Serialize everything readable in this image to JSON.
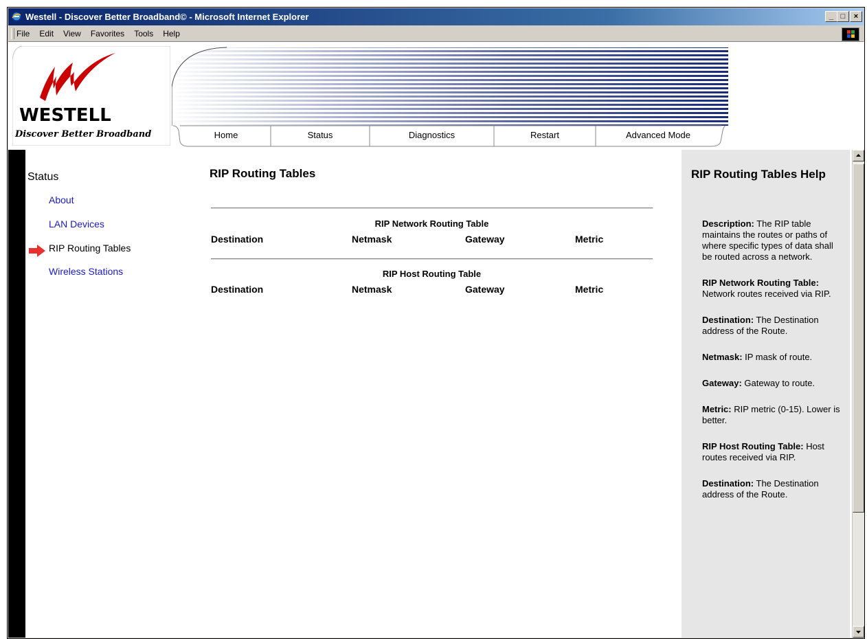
{
  "window": {
    "title": "Westell - Discover Better Broadband© - Microsoft Internet Explorer",
    "controls": {
      "minimize": "_",
      "maximize": "□",
      "close": "×"
    }
  },
  "menubar": {
    "items": [
      "File",
      "Edit",
      "View",
      "Favorites",
      "Tools",
      "Help"
    ]
  },
  "header": {
    "brand": "WESTELL",
    "tagline": "Discover Better Broadband",
    "tabs": [
      "Home",
      "Status",
      "Diagnostics",
      "Restart",
      "Advanced Mode"
    ]
  },
  "sidebar": {
    "heading": "Status",
    "items": [
      {
        "label": "About",
        "state": "link"
      },
      {
        "label": "LAN Devices",
        "state": "link"
      },
      {
        "label": "RIP Routing Tables",
        "state": "current"
      },
      {
        "label": "Wireless Stations",
        "state": "link"
      }
    ]
  },
  "main": {
    "title": "RIP Routing Tables",
    "tables": [
      {
        "title": "RIP Network Routing Table",
        "columns": [
          "Destination",
          "Netmask",
          "Gateway",
          "Metric"
        ]
      },
      {
        "title": "RIP Host Routing Table",
        "columns": [
          "Destination",
          "Netmask",
          "Gateway",
          "Metric"
        ]
      }
    ]
  },
  "help": {
    "title": "RIP Routing Tables Help",
    "entries": [
      {
        "term": "Description:",
        "text": " The RIP table maintains the routes or paths of where specific types of data shall be routed across a network."
      },
      {
        "term": "RIP Network Routing Table:",
        "text": " Network routes received via RIP."
      },
      {
        "term": "Destination:",
        "text": " The Destination address of the Route."
      },
      {
        "term": "Netmask:",
        "text": " IP mask of route."
      },
      {
        "term": "Gateway:",
        "text": " Gateway to route."
      },
      {
        "term": "Metric:",
        "text": " RIP metric (0-15). Lower is better."
      },
      {
        "term": "RIP Host Routing Table:",
        "text": " Host routes received via RIP."
      },
      {
        "term": "Destination:",
        "text": " The Destination address of the Route."
      }
    ]
  },
  "colors": {
    "link": "#1a1acc",
    "brand_red": "#cc0000",
    "arrow_red": "#e83030",
    "stripe_blue": "#1a2a7a"
  }
}
